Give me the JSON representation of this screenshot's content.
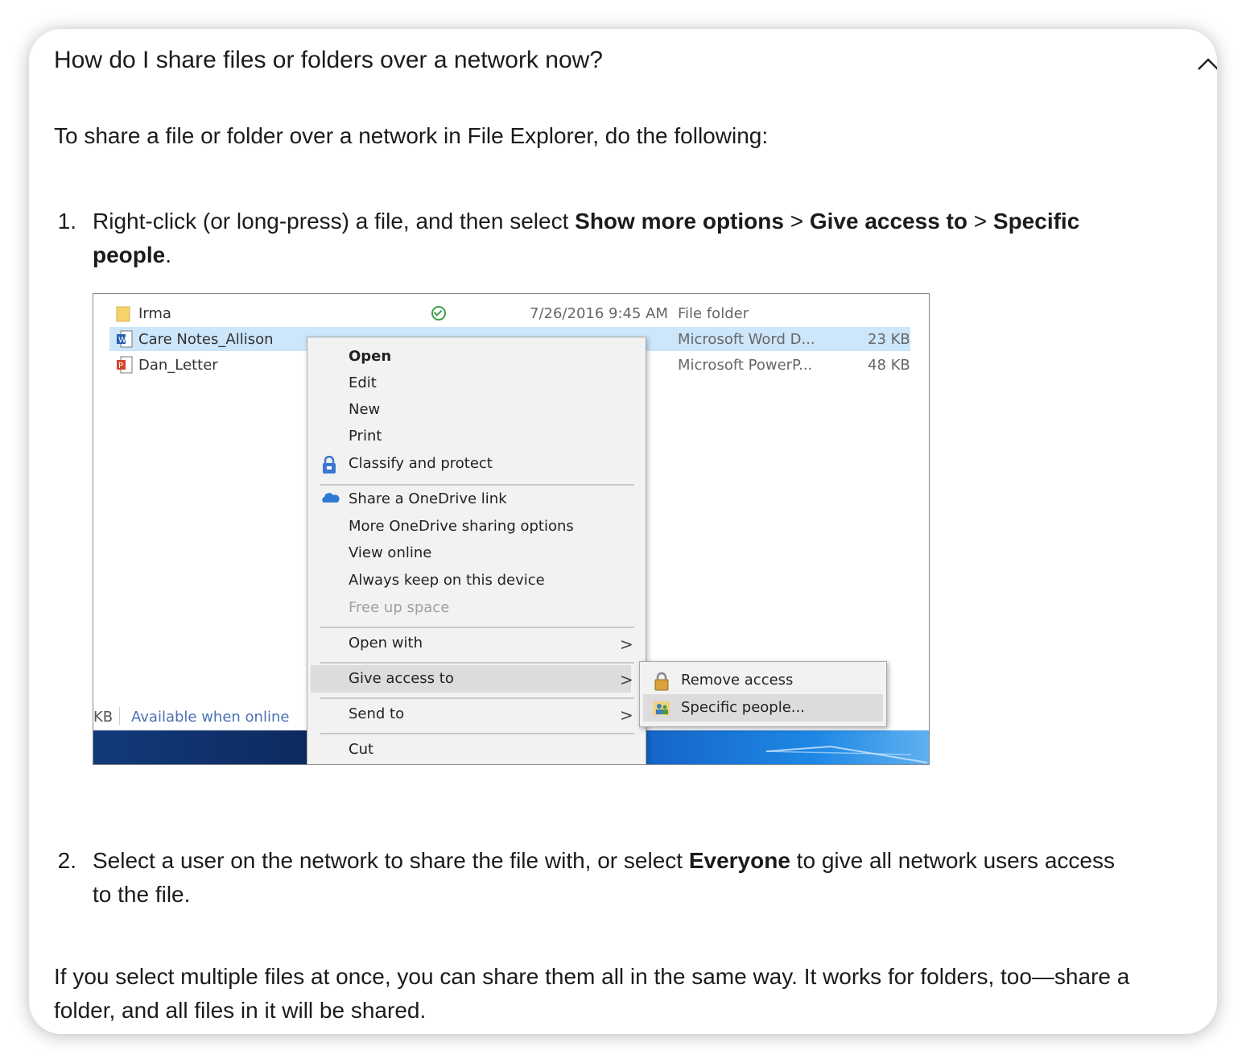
{
  "faq": {
    "question": "How do I share files or folders over a network now?",
    "intro": "To share a file or folder over a network in File Explorer, do the following:",
    "steps": [
      {
        "num": "1.",
        "t1": "Right-click (or long-press) a file, and then select ",
        "b1": "Show more options",
        "t2": " > ",
        "b2": "Give access to",
        "t3": " > ",
        "b3": "Specific people",
        "t4": "."
      },
      {
        "num": "2.",
        "t1": "Select a user on the network to share the file with, or select ",
        "b1": "Everyone",
        "t2": " to give all network users access to the file."
      }
    ],
    "outro": "If you select multiple files at once, you can share them all in the same way. It works for folders, too—share a folder, and all files in it will be shared."
  },
  "screenshot": {
    "files": [
      {
        "name": "Irma",
        "date": "7/26/2016 9:45 AM",
        "type": "File folder",
        "size": "",
        "icon": "folder-icon"
      },
      {
        "name": "Care Notes_Allison",
        "date": "",
        "type": "Microsoft Word D...",
        "size": "23 KB",
        "icon": "word-doc-icon"
      },
      {
        "name": "Dan_Letter",
        "date": "",
        "type": "Microsoft PowerP...",
        "size": "48 KB",
        "icon": "powerpoint-icon"
      }
    ],
    "status_left": "KB",
    "status_text": "Available when online",
    "context_menu": [
      {
        "label": "Open"
      },
      {
        "label": "Edit"
      },
      {
        "label": "New"
      },
      {
        "label": "Print"
      },
      {
        "label": "Classify and protect",
        "icon": "lock-shield-icon"
      },
      {
        "label": "Share a OneDrive link",
        "icon": "onedrive-cloud-icon"
      },
      {
        "label": "More OneDrive sharing options"
      },
      {
        "label": "View online"
      },
      {
        "label": "Always keep on this device"
      },
      {
        "label": "Free up space"
      },
      {
        "label": "Open with"
      },
      {
        "label": "Give access to"
      },
      {
        "label": "Send to"
      },
      {
        "label": "Cut"
      }
    ],
    "chevron": ">",
    "submenu": [
      {
        "label": "Remove access",
        "icon": "padlock-icon"
      },
      {
        "label": "Specific people...",
        "icon": "people-icon"
      }
    ]
  },
  "colors": {
    "selected_row": "#cce6fb",
    "menu_bg": "#f2f2f2",
    "menu_highlight": "#dcdcdc"
  }
}
